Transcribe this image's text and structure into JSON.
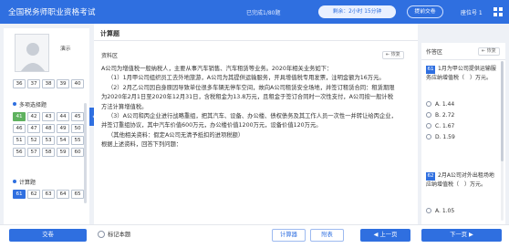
{
  "header": {
    "title": "全国税务师职业资格考试",
    "answered": "已完成1/80题",
    "timer": "剩余：2小时 15分钟",
    "submit_label": "提前交卷",
    "seat": "座位号 1"
  },
  "left": {
    "demo_name": "演示",
    "row_top": [
      "36",
      "37",
      "38",
      "39",
      "40"
    ],
    "section_multi": "多项选择题",
    "multi_rows": [
      [
        "41",
        "42",
        "43",
        "44",
        "45"
      ],
      [
        "46",
        "47",
        "48",
        "49",
        "50"
      ],
      [
        "51",
        "52",
        "53",
        "54",
        "55"
      ],
      [
        "56",
        "57",
        "58",
        "59",
        "60"
      ]
    ],
    "section_calc": "计算题",
    "calc_row": [
      "61",
      "62",
      "63",
      "64",
      "65"
    ],
    "legend": [
      "当前",
      "未答",
      "已答",
      "标记"
    ]
  },
  "main": {
    "section_title": "计算题",
    "material_label": "资料区",
    "restore": "恢复",
    "paragraphs": [
      "A公司为增值税一般纳税人，主要从事汽车销售、汽车租赁等业务。2020年相关业务如下：",
      "（1）1月甲公司组织员工去外地旅游，A公司为其提供运输服务，开具增值税专用发票，注明金额为16万元。",
      "（2）2月乙公司因自身原因导致单位很多车辆无停车空间，故向A公司租赁安全场地，并签订租赁合同：租赁期限",
      "为2020年2月1日至2020年12月31日，含税租金为13.8万元，且租金于签订合同时一次性支付，A公司按一般计税",
      "方法计算增值税。",
      "（3）A公司和丙企业进行战略重组，把其汽车、设备、办公楼、债权债务及其工作人员一次性一并转让给丙企业，",
      "并签订重组协议，其中汽车价值600万元，办公楼价值1200万元，设备价值120万元。",
      "（其他相关资料：假定A公司无清予抵扣的进项税额）",
      "根据上述资料，回答下列问题："
    ]
  },
  "answer": {
    "label": "作答区",
    "restore": "恢复",
    "q1": {
      "num": "61",
      "text": "1月为甲公司提供运输服务应纳增值税（　）万元。",
      "options": [
        "A. 1.44",
        "B. 2.72",
        "C. 1.67",
        "D. 1.59"
      ]
    },
    "q2": {
      "num": "62",
      "text": "2月A公司对外出租场地应纳增值税（　）万元。",
      "options": [
        "A. 1.05"
      ]
    }
  },
  "footer": {
    "submit": "交卷",
    "mark": "标记本题",
    "calculator": "计算器",
    "attachment": "附表",
    "prev": "上一页",
    "next": "下一页"
  },
  "colors": {
    "brand": "#2f6fe0",
    "answered": "#5fb25f"
  }
}
